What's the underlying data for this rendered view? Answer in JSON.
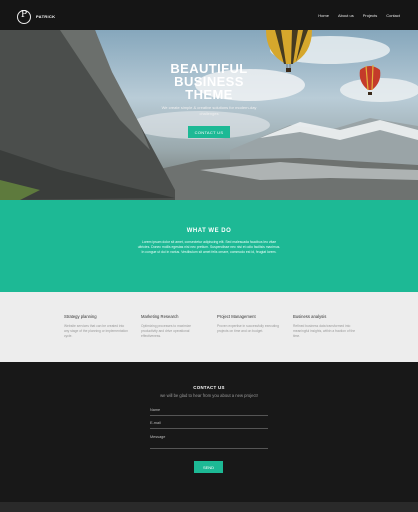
{
  "header": {
    "logo_letter": "P",
    "brand": "PATRICK",
    "nav": [
      "Home",
      "About us",
      "Projects",
      "Contact"
    ]
  },
  "hero": {
    "title_line1": "BEAUTIFUL",
    "title_line2": "BUSINESS",
    "title_line3": "THEME",
    "subtitle": "We create simple & creative solutions for modern-day challenges",
    "button": "CONTACT US"
  },
  "what_we_do": {
    "title": "WHAT WE DO",
    "text": "Lorem ipsum dolor sit amet, consectetur adipiscing elit. Sed malesuada faucibus leo vitae ultricies. Donec mollis egestas nisi nec pretium. Suspendisse nec nisi et odio facilisis maximus. In congue ut dui in varius. Vestibulum sit amet felis ornare, commodo est id, feugiat lorem."
  },
  "services": [
    {
      "title": "Strategy planning",
      "desc": "Website services that can be created into any stage of the planning or implementation cycle."
    },
    {
      "title": "Marketing Research",
      "desc": "Optimizing processes to maximize productivity and drive operational effectiveness."
    },
    {
      "title": "Project Management",
      "desc": "Proven expertise in successfully executing projects on time and on budget."
    },
    {
      "title": "Business analysis",
      "desc": "Refined business data transformed into meaningful insights, within a fraction of the time."
    }
  ],
  "contact": {
    "title": "CONTACT US",
    "subtitle": "we will be glad to hear from you about a new project!",
    "name_placeholder": "Name",
    "email_placeholder": "E-mail",
    "message_placeholder": "Message",
    "send": "SEND"
  },
  "colors": {
    "accent": "#1db995",
    "dark": "#181818",
    "light": "#ededed"
  }
}
